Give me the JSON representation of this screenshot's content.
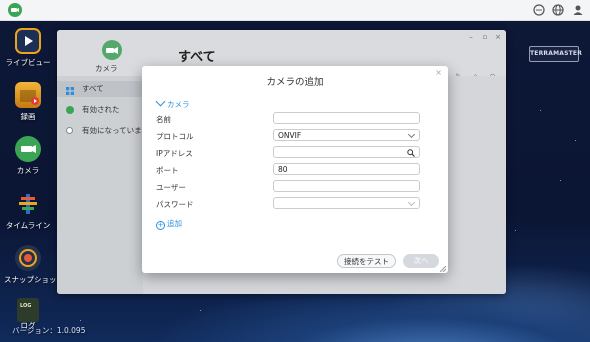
{
  "topbar": {
    "icons": [
      "app-logo-icon",
      "message-icon",
      "globe-icon",
      "user-icon"
    ]
  },
  "dock": {
    "items": [
      {
        "label": "ライブビュー",
        "icon": "live-view-icon"
      },
      {
        "label": "録画",
        "icon": "recording-icon"
      },
      {
        "label": "カメラ",
        "icon": "camera-icon"
      },
      {
        "label": "タイムライン",
        "icon": "timeline-icon"
      },
      {
        "label": "スナップショット",
        "icon": "snapshot-icon"
      },
      {
        "label": "ログ",
        "icon": "log-icon"
      }
    ],
    "log_badge": "LOG",
    "version": "バージョン：1.0.095"
  },
  "brand": {
    "text": "TERRAMASTER"
  },
  "app": {
    "logo_label": "カメラ",
    "title": "すべて",
    "sidebar": [
      {
        "label": "すべて",
        "icon": "grid-icon"
      },
      {
        "label": "有効された",
        "icon": "check-circle-icon"
      },
      {
        "label": "有効になっていません",
        "icon": "disabled-circle-icon"
      }
    ]
  },
  "modal": {
    "title": "カメラの追加",
    "section": "カメラ",
    "fields": [
      {
        "label": "名前",
        "value": ""
      },
      {
        "label": "プロトコル",
        "value": "ONVIF"
      },
      {
        "label": "IPアドレス",
        "value": ""
      },
      {
        "label": "ポート",
        "value": "80"
      },
      {
        "label": "ユーザー",
        "value": ""
      },
      {
        "label": "パスワード",
        "value": ""
      }
    ],
    "add_label": "追加",
    "test_button": "接続をテスト",
    "next_button": "次へ"
  },
  "colors": {
    "accent": "#2a8fe0",
    "brand_green": "#3aa655"
  }
}
